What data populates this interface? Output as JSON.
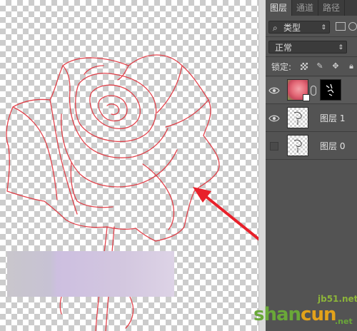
{
  "panel": {
    "tabs": [
      {
        "label": "图层",
        "active": true
      },
      {
        "label": "通道",
        "active": false
      },
      {
        "label": "路径",
        "active": false
      }
    ],
    "filter": {
      "icon": "search-icon",
      "label": "类型"
    },
    "blend_mode": "正常",
    "lock_label": "锁定:",
    "lock_icons": [
      "lock-transparency-icon",
      "lock-image-icon",
      "lock-position-icon"
    ],
    "layers": [
      {
        "name": "",
        "visible": true,
        "thumb": "rose-photo",
        "has_mask": true
      },
      {
        "name": "图层 1",
        "visible": true,
        "thumb": "line-sketch",
        "has_mask": false
      },
      {
        "name": "图层 0",
        "visible": false,
        "thumb": "line-sketch",
        "has_mask": false
      }
    ]
  },
  "watermark": {
    "top": "jb51.net",
    "main_a": "shan",
    "main_b": "cun",
    "net": ".net"
  },
  "colors": {
    "outline": "#e0303a",
    "arrow": "#e8202a",
    "panel_bg": "#535353"
  }
}
